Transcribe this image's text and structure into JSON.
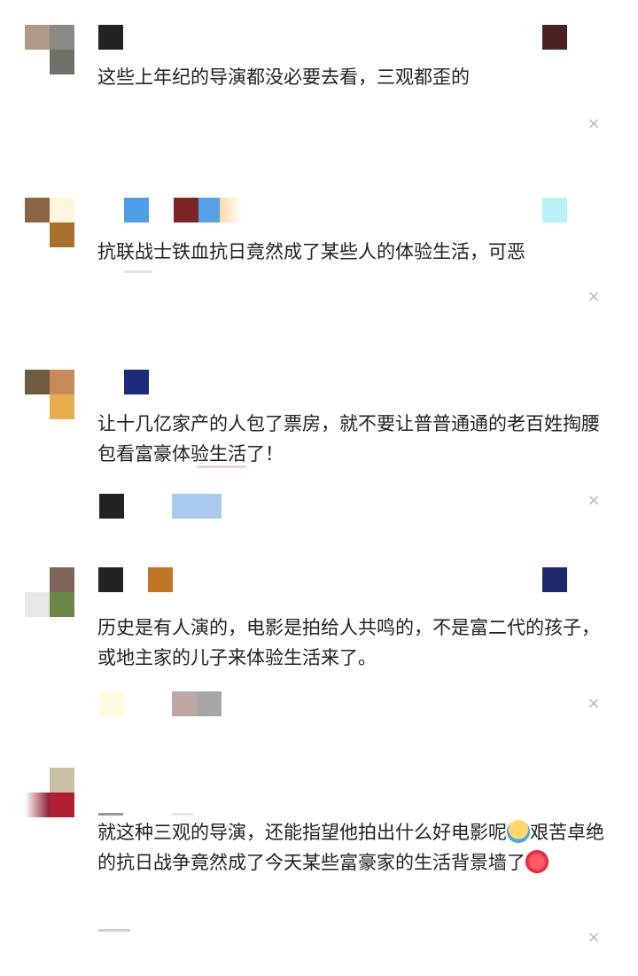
{
  "comments": [
    {
      "text": "这些上年纪的导演都没必要去看，三观都歪的",
      "close": "×"
    },
    {
      "text": "抗联战士铁血抗日竟然成了某些人的体验生活，可恶",
      "close": "×"
    },
    {
      "text": "让十几亿家产的人包了票房，就不要让普普通通的老百姓掏腰包看富豪体验生活了！",
      "close": "×"
    },
    {
      "text": "历史是有人演的，电影是拍给人共鸣的，不是富二代的孩子，或地主家的儿子来体验生活来了。",
      "close": "×"
    },
    {
      "text_part1": "就这种三观的导演，还能指望他拍出什么好电影呢",
      "text_part2": "艰苦卓绝的抗日战争竟然成了今天某些富豪家的生活背景墙了",
      "close": "×"
    }
  ],
  "emoji": [
    "crying-face-emoji",
    "angry-face-emoji"
  ]
}
